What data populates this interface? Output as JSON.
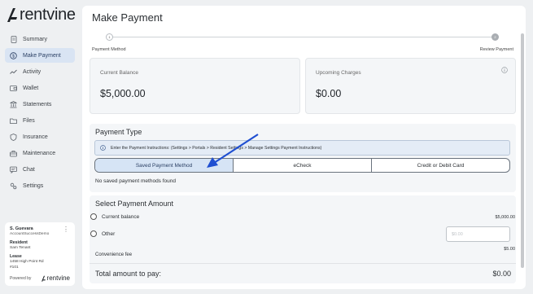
{
  "brand": {
    "name": "rentvine"
  },
  "page_title": "Make Payment",
  "nav": [
    {
      "label": "Summary",
      "icon": "document-icon",
      "active": false
    },
    {
      "label": "Make Payment",
      "icon": "dollar-circle-icon",
      "active": true
    },
    {
      "label": "Activity",
      "icon": "activity-icon",
      "active": false
    },
    {
      "label": "Wallet",
      "icon": "wallet-icon",
      "active": false
    },
    {
      "label": "Statements",
      "icon": "bank-icon",
      "active": false
    },
    {
      "label": "Files",
      "icon": "folder-icon",
      "active": false
    },
    {
      "label": "Insurance",
      "icon": "shield-icon",
      "active": false
    },
    {
      "label": "Maintenance",
      "icon": "toolbox-icon",
      "active": false
    },
    {
      "label": "Chat",
      "icon": "chat-icon",
      "active": false
    },
    {
      "label": "Settings",
      "icon": "settings-icon",
      "active": false
    }
  ],
  "profile": {
    "name": "S. Guevara",
    "account": "AccountSuccessDemo",
    "resident_label": "Resident",
    "resident_value": "Sam Tenant",
    "lease_label": "Lease",
    "lease_line1": "1458 High Point Rd",
    "lease_line2": "#101",
    "powered_by": "Powered by",
    "powered_brand": "rentvine"
  },
  "stepper": {
    "step1_number": "1",
    "step1_label": "Payment Method",
    "step2_number": "2",
    "step2_label": "Review Payment"
  },
  "balance": {
    "label": "Current Balance",
    "value": "$5,000.00"
  },
  "upcoming": {
    "label": "Upcoming Charges",
    "value": "$0.00"
  },
  "payment_type": {
    "title": "Payment Type",
    "instructions": "Enter the Payment Instructions: (Settings > Portals > Resident Settings > Manage Settings Payment Instructions)",
    "options": [
      "Saved Payment Method",
      "eCheck",
      "Credit or Debit Card"
    ],
    "selected_index": 0,
    "empty_message": "No saved payment methods found"
  },
  "amount": {
    "title": "Select Payment Amount",
    "current_label": "Current balance",
    "current_value": "$5,000.00",
    "other_label": "Other",
    "other_placeholder": "$0.00",
    "fee_label": "Convenience fee",
    "fee_value": "$5.00",
    "total_label": "Total amount to pay:",
    "total_value": "$0.00"
  },
  "colors": {
    "active_nav_bg": "#d9e4f3",
    "selected_segment_bg": "#d6e4f5",
    "annotation_arrow": "#1f4fd1"
  }
}
